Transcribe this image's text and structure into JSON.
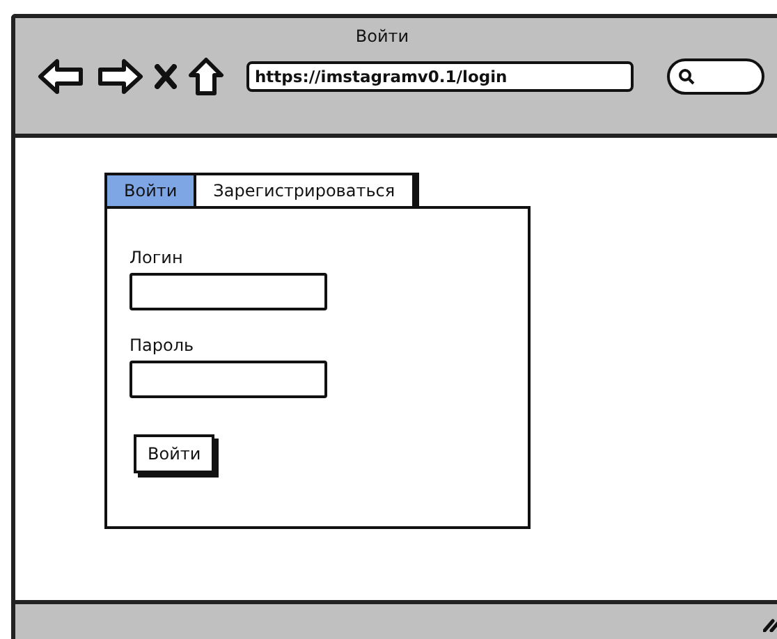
{
  "window": {
    "title": "Войти"
  },
  "toolbar": {
    "url": "https://imstagramv0.1/login"
  },
  "tabs": [
    {
      "label": "Войти",
      "selected": true
    },
    {
      "label": "Зарегистрироваться",
      "selected": false
    }
  ],
  "form": {
    "fields": [
      {
        "label": "Логин"
      },
      {
        "label": "Пароль"
      }
    ],
    "submit": "Войти"
  }
}
